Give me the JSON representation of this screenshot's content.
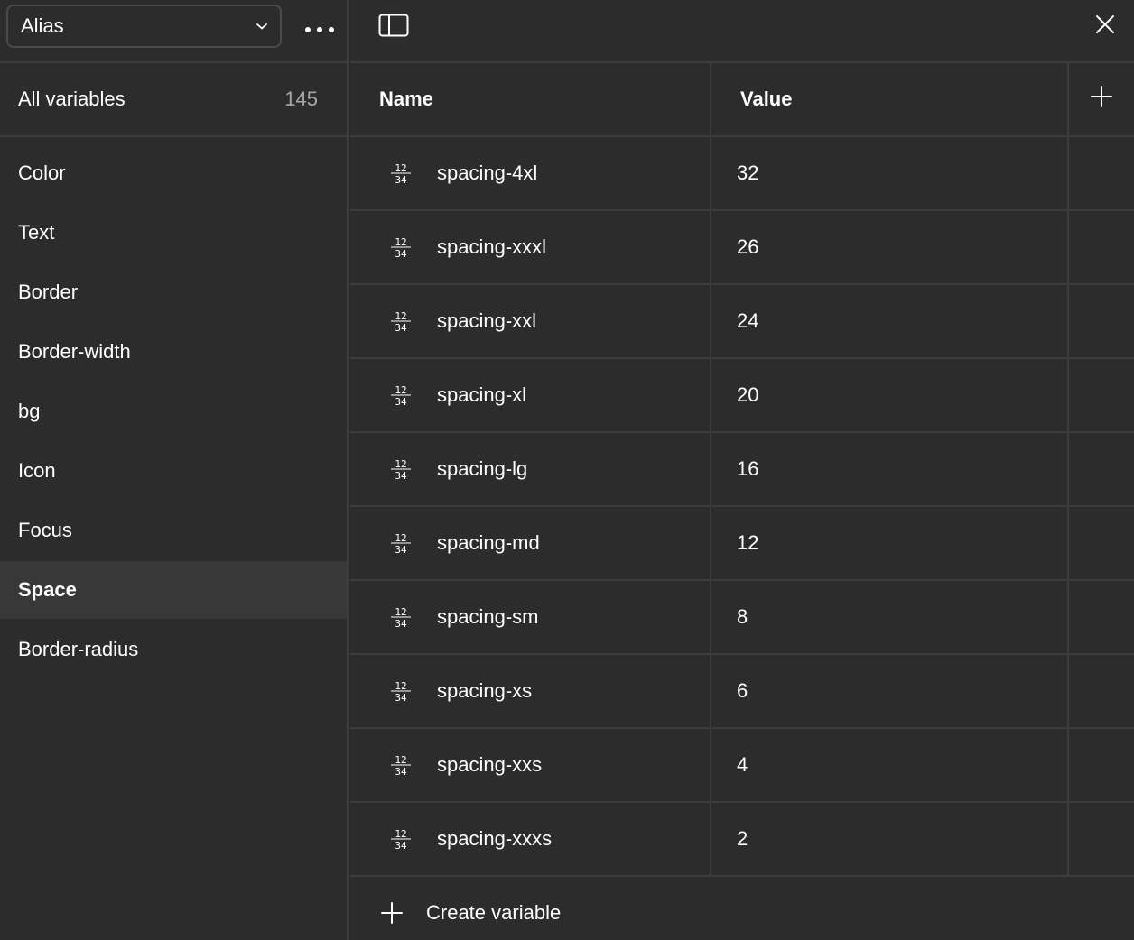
{
  "sidebar": {
    "mode_select": {
      "label": "Alias"
    },
    "all_variables": {
      "label": "All variables",
      "count": "145"
    },
    "groups": [
      {
        "label": "Color"
      },
      {
        "label": "Text"
      },
      {
        "label": "Border"
      },
      {
        "label": "Border-width"
      },
      {
        "label": "bg"
      },
      {
        "label": "Icon"
      },
      {
        "label": "Focus"
      },
      {
        "label": "Space",
        "selected": true
      },
      {
        "label": "Border-radius"
      }
    ]
  },
  "table": {
    "headers": {
      "name": "Name",
      "value": "Value"
    },
    "rows": [
      {
        "icon": "number-icon",
        "name": "spacing-4xl",
        "value": "32"
      },
      {
        "icon": "number-icon",
        "name": "spacing-xxxl",
        "value": "26"
      },
      {
        "icon": "number-icon",
        "name": "spacing-xxl",
        "value": "24"
      },
      {
        "icon": "number-icon",
        "name": "spacing-xl",
        "value": "20"
      },
      {
        "icon": "number-icon",
        "name": "spacing-lg",
        "value": "16"
      },
      {
        "icon": "number-icon",
        "name": "spacing-md",
        "value": "12"
      },
      {
        "icon": "number-icon",
        "name": "spacing-sm",
        "value": "8"
      },
      {
        "icon": "number-icon",
        "name": "spacing-xs",
        "value": "6"
      },
      {
        "icon": "number-icon",
        "name": "spacing-xxs",
        "value": "4"
      },
      {
        "icon": "number-icon",
        "name": "spacing-xxxs",
        "value": "2"
      }
    ],
    "create_label": "Create variable"
  },
  "colors": {
    "background": "#2c2c2c",
    "selected_row": "#383838",
    "divider": "#3d3d3d",
    "muted_text": "#a8a8a8"
  }
}
